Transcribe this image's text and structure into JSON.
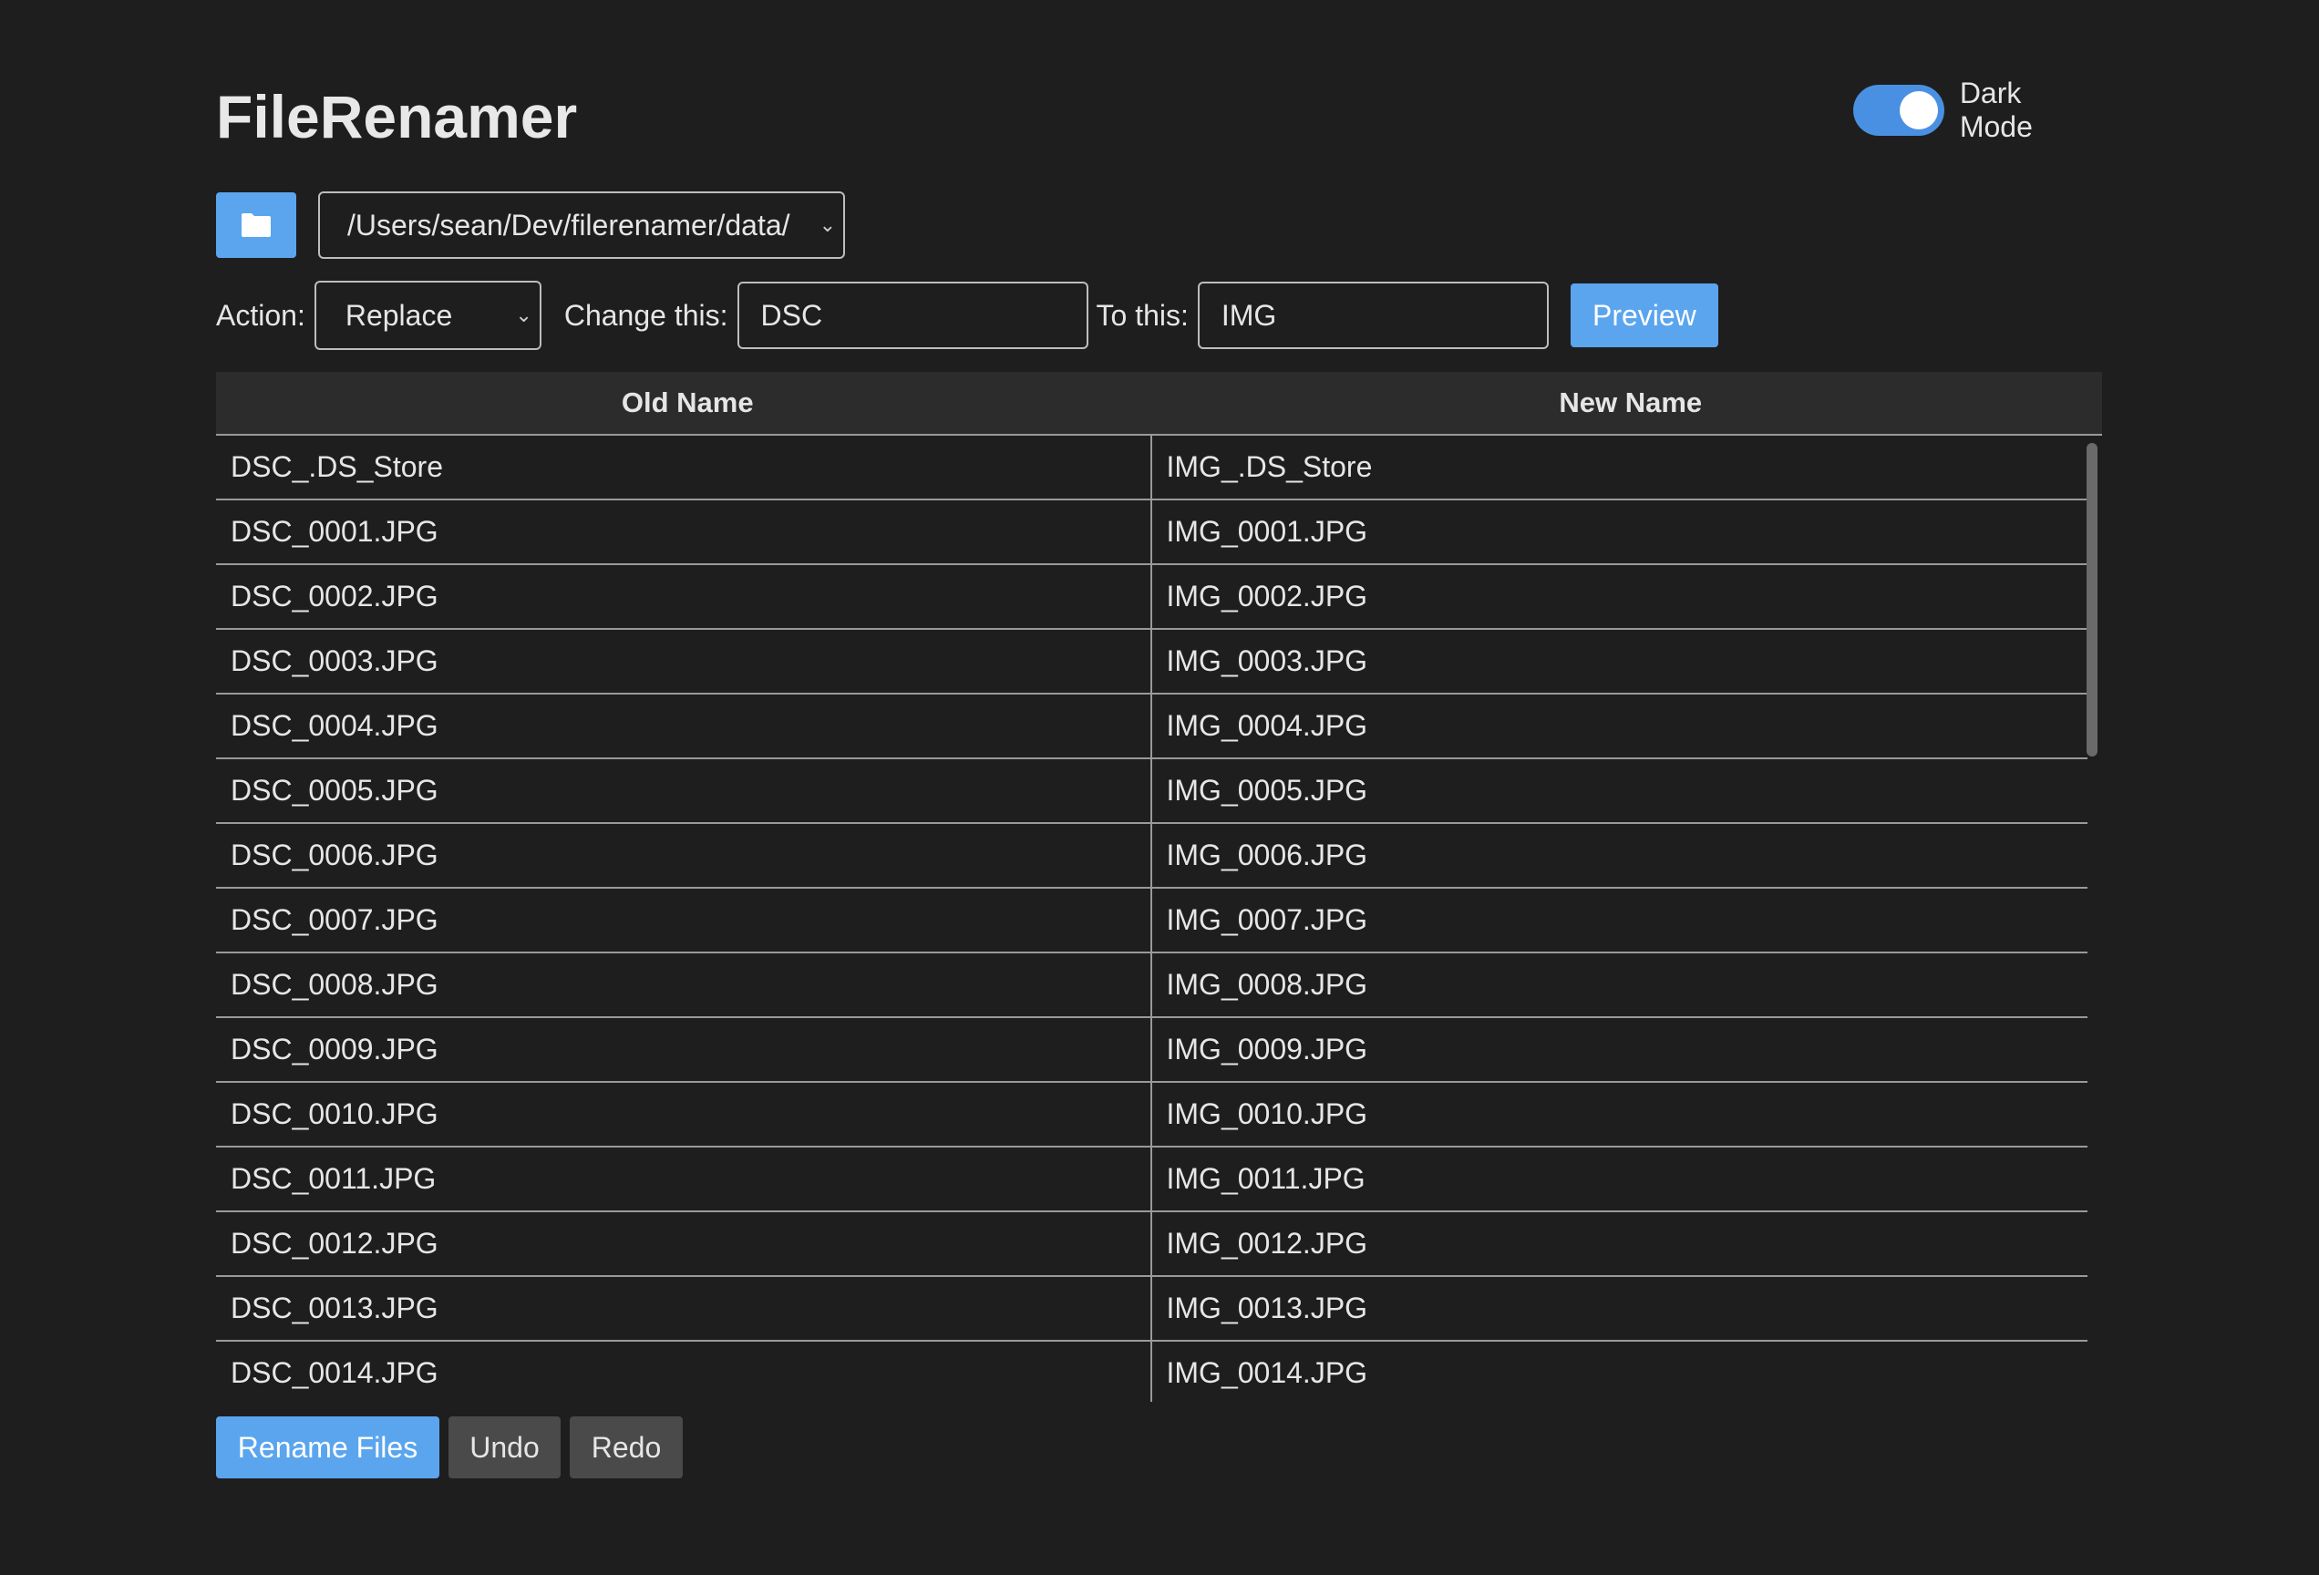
{
  "app": {
    "title": "FileRenamer",
    "dark_mode_label": "Dark Mode",
    "dark_mode_on": true,
    "accent_color": "#5aa5ee"
  },
  "folder": {
    "button_icon": "folder-icon",
    "path": "/Users/sean/Dev/filerenamer/data/"
  },
  "controls": {
    "action_label": "Action:",
    "action_value": "Replace",
    "change_label": "Change this:",
    "change_value": "DSC",
    "to_label": "To this:",
    "to_value": "IMG",
    "preview_label": "Preview"
  },
  "table": {
    "headers": [
      "Old Name",
      "New Name"
    ],
    "rows": [
      {
        "old": "DSC_.DS_Store",
        "new": "IMG_.DS_Store"
      },
      {
        "old": "DSC_0001.JPG",
        "new": "IMG_0001.JPG"
      },
      {
        "old": "DSC_0002.JPG",
        "new": "IMG_0002.JPG"
      },
      {
        "old": "DSC_0003.JPG",
        "new": "IMG_0003.JPG"
      },
      {
        "old": "DSC_0004.JPG",
        "new": "IMG_0004.JPG"
      },
      {
        "old": "DSC_0005.JPG",
        "new": "IMG_0005.JPG"
      },
      {
        "old": "DSC_0006.JPG",
        "new": "IMG_0006.JPG"
      },
      {
        "old": "DSC_0007.JPG",
        "new": "IMG_0007.JPG"
      },
      {
        "old": "DSC_0008.JPG",
        "new": "IMG_0008.JPG"
      },
      {
        "old": "DSC_0009.JPG",
        "new": "IMG_0009.JPG"
      },
      {
        "old": "DSC_0010.JPG",
        "new": "IMG_0010.JPG"
      },
      {
        "old": "DSC_0011.JPG",
        "new": "IMG_0011.JPG"
      },
      {
        "old": "DSC_0012.JPG",
        "new": "IMG_0012.JPG"
      },
      {
        "old": "DSC_0013.JPG",
        "new": "IMG_0013.JPG"
      },
      {
        "old": "DSC_0014.JPG",
        "new": "IMG_0014.JPG"
      }
    ]
  },
  "actions": {
    "rename_label": "Rename Files",
    "undo_label": "Undo",
    "redo_label": "Redo"
  }
}
